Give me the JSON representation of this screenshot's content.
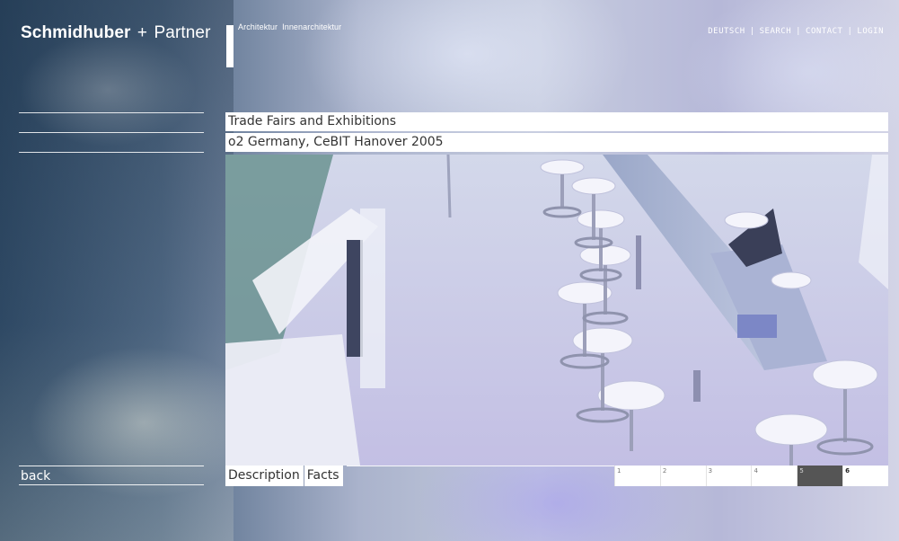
{
  "brand": {
    "name_bold": "Schmidhuber",
    "plus": "+",
    "name_rest": "Partner",
    "tagline_1": "Architektur",
    "tagline_2": "Innenarchitektur"
  },
  "topnav": {
    "items": [
      "DEUTSCH",
      "SEARCH",
      "CONTACT",
      "LOGIN"
    ],
    "separator": "|"
  },
  "content": {
    "category": "Trade Fairs and Exhibitions",
    "project": "o2 Germany, CeBIT Hanover 2005"
  },
  "bottom": {
    "back_label": "back",
    "tabs": [
      "Description",
      "Facts"
    ],
    "pages": [
      "1",
      "2",
      "3",
      "4",
      "5",
      "6"
    ],
    "active_page_index": 4,
    "current_page_index": 5
  },
  "colors": {
    "panel": "#ffffff",
    "text": "#333333",
    "active_page": "#555555"
  }
}
